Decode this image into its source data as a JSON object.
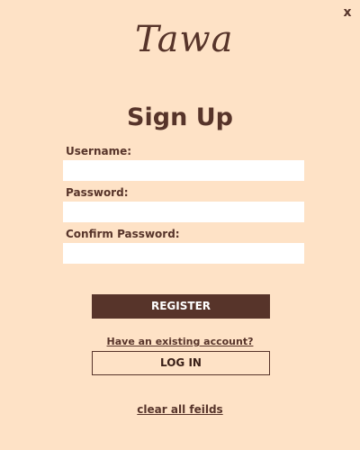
{
  "window": {
    "close_label": "x",
    "logo_text": "Tawa"
  },
  "form": {
    "title": "Sign Up",
    "username_label": "Username:",
    "username_value": "",
    "password_label": "Password:",
    "password_value": "",
    "confirm_password_label": "Confirm Password:",
    "confirm_password_value": "",
    "register_label": "REGISTER"
  },
  "footer": {
    "existing_account_link": "Have an existing account?",
    "login_label": "LOG IN",
    "clear_fields_link": "clear all feilds"
  },
  "colors": {
    "background": "#fee2c6",
    "accent": "#57342a",
    "field_background": "#ffffff"
  }
}
